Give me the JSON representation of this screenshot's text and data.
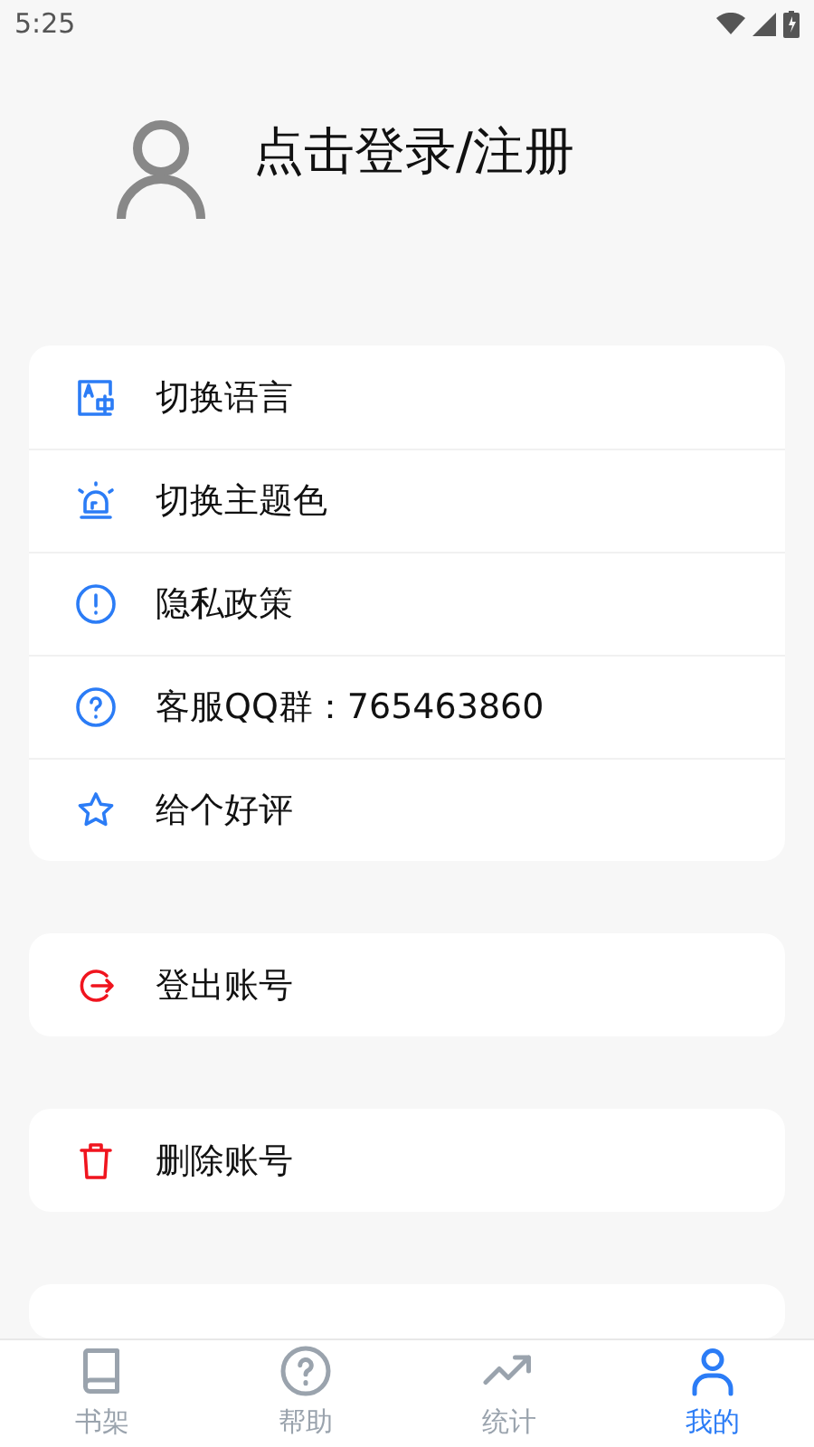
{
  "status_bar": {
    "time": "5:25"
  },
  "profile": {
    "login_text": "点击登录/注册"
  },
  "groups": [
    {
      "items": [
        {
          "kind": "language",
          "label": "切换语言",
          "color": "#2b7cf6"
        },
        {
          "kind": "theme",
          "label": "切换主题色",
          "color": "#2b7cf6"
        },
        {
          "kind": "info",
          "label": "隐私政策",
          "color": "#2b7cf6"
        },
        {
          "kind": "help",
          "label": "客服QQ群：765463860",
          "color": "#2b7cf6"
        },
        {
          "kind": "star",
          "label": "给个好评",
          "color": "#2b7cf6"
        }
      ]
    },
    {
      "items": [
        {
          "kind": "logout",
          "label": "登出账号",
          "color": "#f0141e"
        }
      ]
    },
    {
      "items": [
        {
          "kind": "delete",
          "label": "删除账号",
          "color": "#f0141e"
        }
      ]
    }
  ],
  "bottom_nav": [
    {
      "kind": "book",
      "label": "书架",
      "selected": false
    },
    {
      "kind": "help",
      "label": "帮助",
      "selected": false
    },
    {
      "kind": "trend",
      "label": "统计",
      "selected": false
    },
    {
      "kind": "user",
      "label": "我的",
      "selected": true
    }
  ]
}
